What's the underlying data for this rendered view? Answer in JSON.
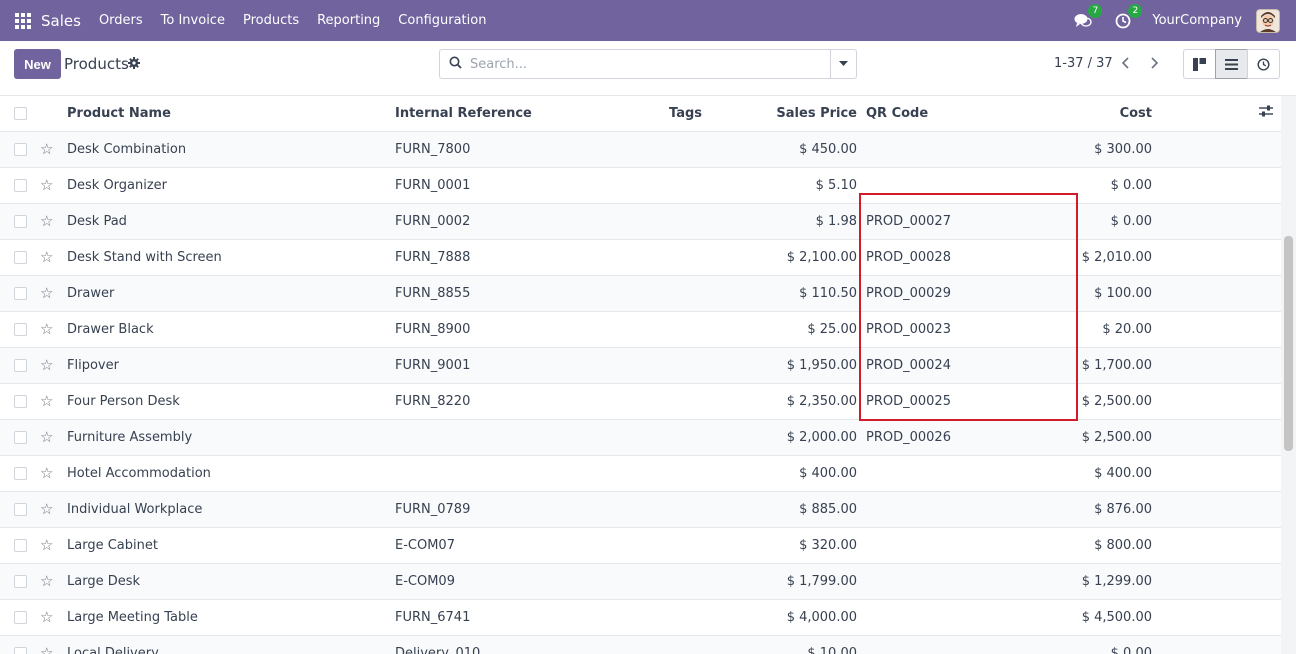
{
  "navbar": {
    "app_name": "Sales",
    "menu": [
      "Orders",
      "To Invoice",
      "Products",
      "Reporting",
      "Configuration"
    ],
    "messages_count": "7",
    "activities_count": "2",
    "company": "YourCompany"
  },
  "control_panel": {
    "new_label": "New",
    "title": "Products",
    "search_placeholder": "Search...",
    "pager": "1-37 / 37"
  },
  "table": {
    "headers": {
      "name": "Product Name",
      "internal_ref": "Internal Reference",
      "tags": "Tags",
      "sales_price": "Sales Price",
      "qr_code": "QR Code",
      "cost": "Cost"
    },
    "rows": [
      {
        "name": "Desk Combination",
        "ref": "FURN_7800",
        "price": "$ 450.00",
        "qr": "",
        "cost": "$ 300.00"
      },
      {
        "name": "Desk Organizer",
        "ref": "FURN_0001",
        "price": "$ 5.10",
        "qr": "",
        "cost": "$ 0.00"
      },
      {
        "name": "Desk Pad",
        "ref": "FURN_0002",
        "price": "$ 1.98",
        "qr": "PROD_00027",
        "cost": "$ 0.00"
      },
      {
        "name": "Desk Stand with Screen",
        "ref": "FURN_7888",
        "price": "$ 2,100.00",
        "qr": "PROD_00028",
        "cost": "$ 2,010.00"
      },
      {
        "name": "Drawer",
        "ref": "FURN_8855",
        "price": "$ 110.50",
        "qr": "PROD_00029",
        "cost": "$ 100.00"
      },
      {
        "name": "Drawer Black",
        "ref": "FURN_8900",
        "price": "$ 25.00",
        "qr": "PROD_00023",
        "cost": "$ 20.00"
      },
      {
        "name": "Flipover",
        "ref": "FURN_9001",
        "price": "$ 1,950.00",
        "qr": "PROD_00024",
        "cost": "$ 1,700.00"
      },
      {
        "name": "Four Person Desk",
        "ref": "FURN_8220",
        "price": "$ 2,350.00",
        "qr": "PROD_00025",
        "cost": "$ 2,500.00"
      },
      {
        "name": "Furniture Assembly",
        "ref": "",
        "price": "$ 2,000.00",
        "qr": "PROD_00026",
        "cost": "$ 2,500.00"
      },
      {
        "name": "Hotel Accommodation",
        "ref": "",
        "price": "$ 400.00",
        "qr": "",
        "cost": "$ 400.00"
      },
      {
        "name": "Individual Workplace",
        "ref": "FURN_0789",
        "price": "$ 885.00",
        "qr": "",
        "cost": "$ 876.00"
      },
      {
        "name": "Large Cabinet",
        "ref": "E-COM07",
        "price": "$ 320.00",
        "qr": "",
        "cost": "$ 800.00"
      },
      {
        "name": "Large Desk",
        "ref": "E-COM09",
        "price": "$ 1,799.00",
        "qr": "",
        "cost": "$ 1,299.00"
      },
      {
        "name": "Large Meeting Table",
        "ref": "FURN_6741",
        "price": "$ 4,000.00",
        "qr": "",
        "cost": "$ 4,500.00"
      },
      {
        "name": "Local Delivery",
        "ref": "Delivery_010",
        "price": "$ 10.00",
        "qr": "",
        "cost": "$ 0.00"
      }
    ]
  },
  "colors": {
    "brand": "#71639e",
    "highlight": "#d11a2a",
    "badge": "#28a745"
  }
}
